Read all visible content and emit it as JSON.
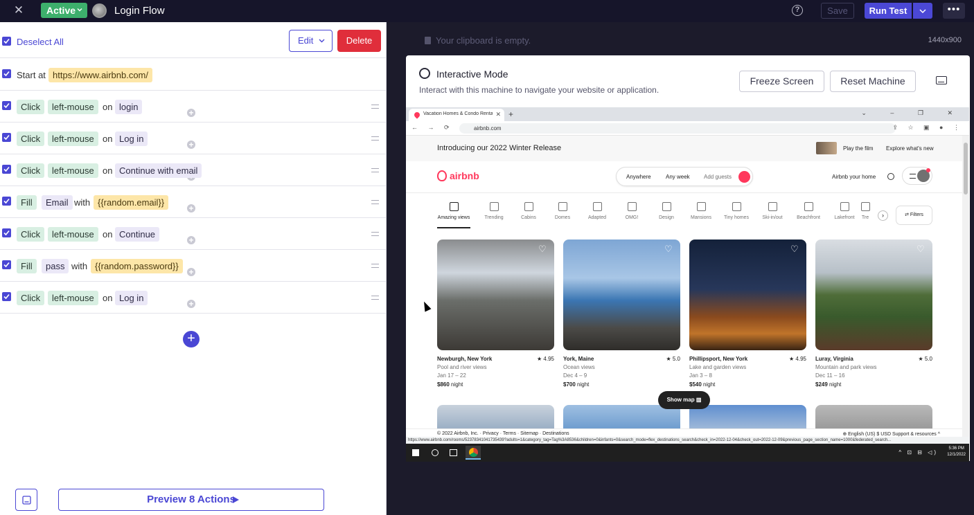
{
  "topbar": {
    "status": "Active",
    "flow_title": "Login Flow",
    "save_label": "Save",
    "run_label": "Run Test",
    "more_label": "•••",
    "help_label": "?"
  },
  "steps_panel": {
    "deselect_label": "Deselect All",
    "edit_label": "Edit",
    "delete_label": "Delete",
    "steps": [
      {
        "parts": [
          "Start at",
          "https://www.airbnb.com/"
        ]
      },
      {
        "parts": [
          "Click",
          "left-mouse",
          "on",
          "login"
        ]
      },
      {
        "parts": [
          "Click",
          "left-mouse",
          "on",
          "Log in"
        ]
      },
      {
        "parts": [
          "Click",
          "left-mouse",
          "on",
          "Continue with email"
        ]
      },
      {
        "parts": [
          "Fill",
          "Email",
          "with",
          "{{random.email}}"
        ]
      },
      {
        "parts": [
          "Click",
          "left-mouse",
          "on",
          "Continue"
        ]
      },
      {
        "parts": [
          "Fill",
          "pass",
          "with",
          "{{random.password}}"
        ]
      },
      {
        "parts": [
          "Click",
          "left-mouse",
          "on",
          "Log in"
        ]
      }
    ],
    "preview_label": "Preview 8 Actions",
    "add_label": "+"
  },
  "machine_panel": {
    "clipboard_text": "Your clipboard is empty.",
    "resolution": "1440x900",
    "title": "Interactive Mode",
    "subtitle": "Interact with this machine to navigate your website or application.",
    "freeze_label": "Freeze Screen",
    "reset_label": "Reset Machine"
  },
  "browser": {
    "tab_title": "Vacation Homes & Condo Rentals",
    "tab_close": "✕",
    "new_tab": "+",
    "window_controls": "⌄ – ❐ ✕",
    "nav_icons": "← → ⟳ ⌂",
    "url": "airbnb.com",
    "addr_icons": "⇪ ☆ ▣ ● ⋮",
    "status_url": "https://www.airbnb.com/rooms/52378341041735439?adults=1&category_tag=Tag%3A8536&children=0&infants=0&search_mode=flex_destinations_search&check_in=2022-12-04&check_out=2022-12-09&previous_page_section_name=1000&federated_search..."
  },
  "airbnb": {
    "promo": "Introducing our 2022 Winter Release",
    "play_film": "Play the film",
    "explore": "Explore what's new",
    "logo_text": "airbnb",
    "search_anywhere": "Anywhere",
    "search_week": "Any week",
    "search_guests": "Add guests",
    "host_label": "Airbnb your home",
    "categories": [
      "Amazing views",
      "Trending",
      "Cabins",
      "Domes",
      "Adapted",
      "OMG!",
      "Design",
      "Mansions",
      "Tiny homes",
      "Ski-in/out",
      "Beachfront",
      "Lakefront",
      "Tre"
    ],
    "cats_next": "›",
    "filters_label": "⇄ Filters",
    "listings": [
      {
        "name": "Newburgh, New York",
        "rating": "★ 4.95",
        "view": "Pool and river views",
        "dates": "Jan 17 – 22",
        "price": "$860",
        "unit": " night"
      },
      {
        "name": "York, Maine",
        "rating": "★ 5.0",
        "view": "Ocean views",
        "dates": "Dec 4 – 9",
        "price": "$700",
        "unit": " night"
      },
      {
        "name": "Phillipsport, New York",
        "rating": "★ 4.95",
        "view": "Lake and garden views",
        "dates": "Jan 3 – 8",
        "price": "$540",
        "unit": " night"
      },
      {
        "name": "Luray, Virginia",
        "rating": "★ 5.0",
        "view": "Mountain and park views",
        "dates": "Dec 11 – 16",
        "price": "$249",
        "unit": " night"
      }
    ],
    "heart": "♡",
    "show_map": "Show map ▥",
    "footer_left": "© 2022 Airbnb, Inc.  ·  Privacy  ·  Terms  ·  Sitemap  ·  Destinations",
    "footer_right": "⊕ English (US)    $ USD    Support & resources ^"
  },
  "taskbar": {
    "tray": "^ ⊡ ⊟ ◁)",
    "time": "5:36 PM",
    "date": "12/1/2022"
  },
  "colors": {
    "accent": "#4a47d4",
    "active_green": "#3daf6c",
    "delete_red": "#e02e3b",
    "airbnb_red": "#ff385c"
  }
}
